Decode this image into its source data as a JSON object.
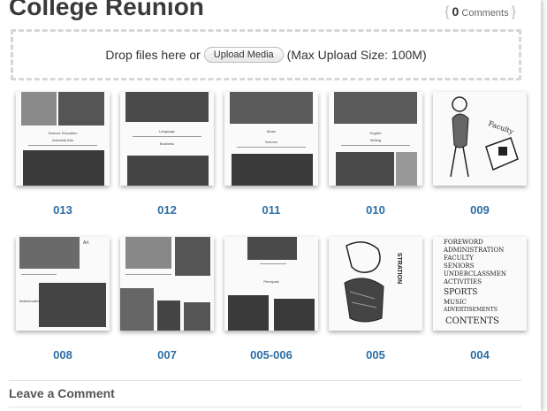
{
  "page": {
    "title": "College Reunion",
    "comments": {
      "count": "0",
      "label": "Comments"
    }
  },
  "upload": {
    "prefix": "Drop files here or",
    "button_label": "Upload Media",
    "suffix": "(Max Upload Size: 100M)"
  },
  "gallery": {
    "row1": [
      {
        "label": "013"
      },
      {
        "label": "012"
      },
      {
        "label": "011"
      },
      {
        "label": "010"
      },
      {
        "label": "009"
      }
    ],
    "row2": [
      {
        "label": "008"
      },
      {
        "label": "007"
      },
      {
        "label": "005-006"
      },
      {
        "label": "005"
      },
      {
        "label": "004"
      }
    ]
  },
  "comments_section": {
    "heading": "Leave a Comment"
  },
  "thumb_text": {
    "t013": [
      "Science Education",
      "Industrial Arts"
    ],
    "t012": [
      "Language",
      "Business"
    ],
    "t011": [
      "Music",
      "Science"
    ],
    "t010": [
      "English",
      "Writing"
    ],
    "t009": [
      "Faculty"
    ],
    "t008": [
      "Art",
      "Mathematics"
    ],
    "t0056": [
      "Principals"
    ],
    "t005": [
      "STRATION"
    ],
    "t004": [
      "FOREWORD",
      "ADMINISTRATION",
      "FACULTY",
      "SENIORS",
      "UNDERCLASSMEN",
      "ACTIVITIES",
      "SPORTS",
      "MUSIC",
      "ADVERTISEMENTS",
      "CONTENTS"
    ]
  }
}
